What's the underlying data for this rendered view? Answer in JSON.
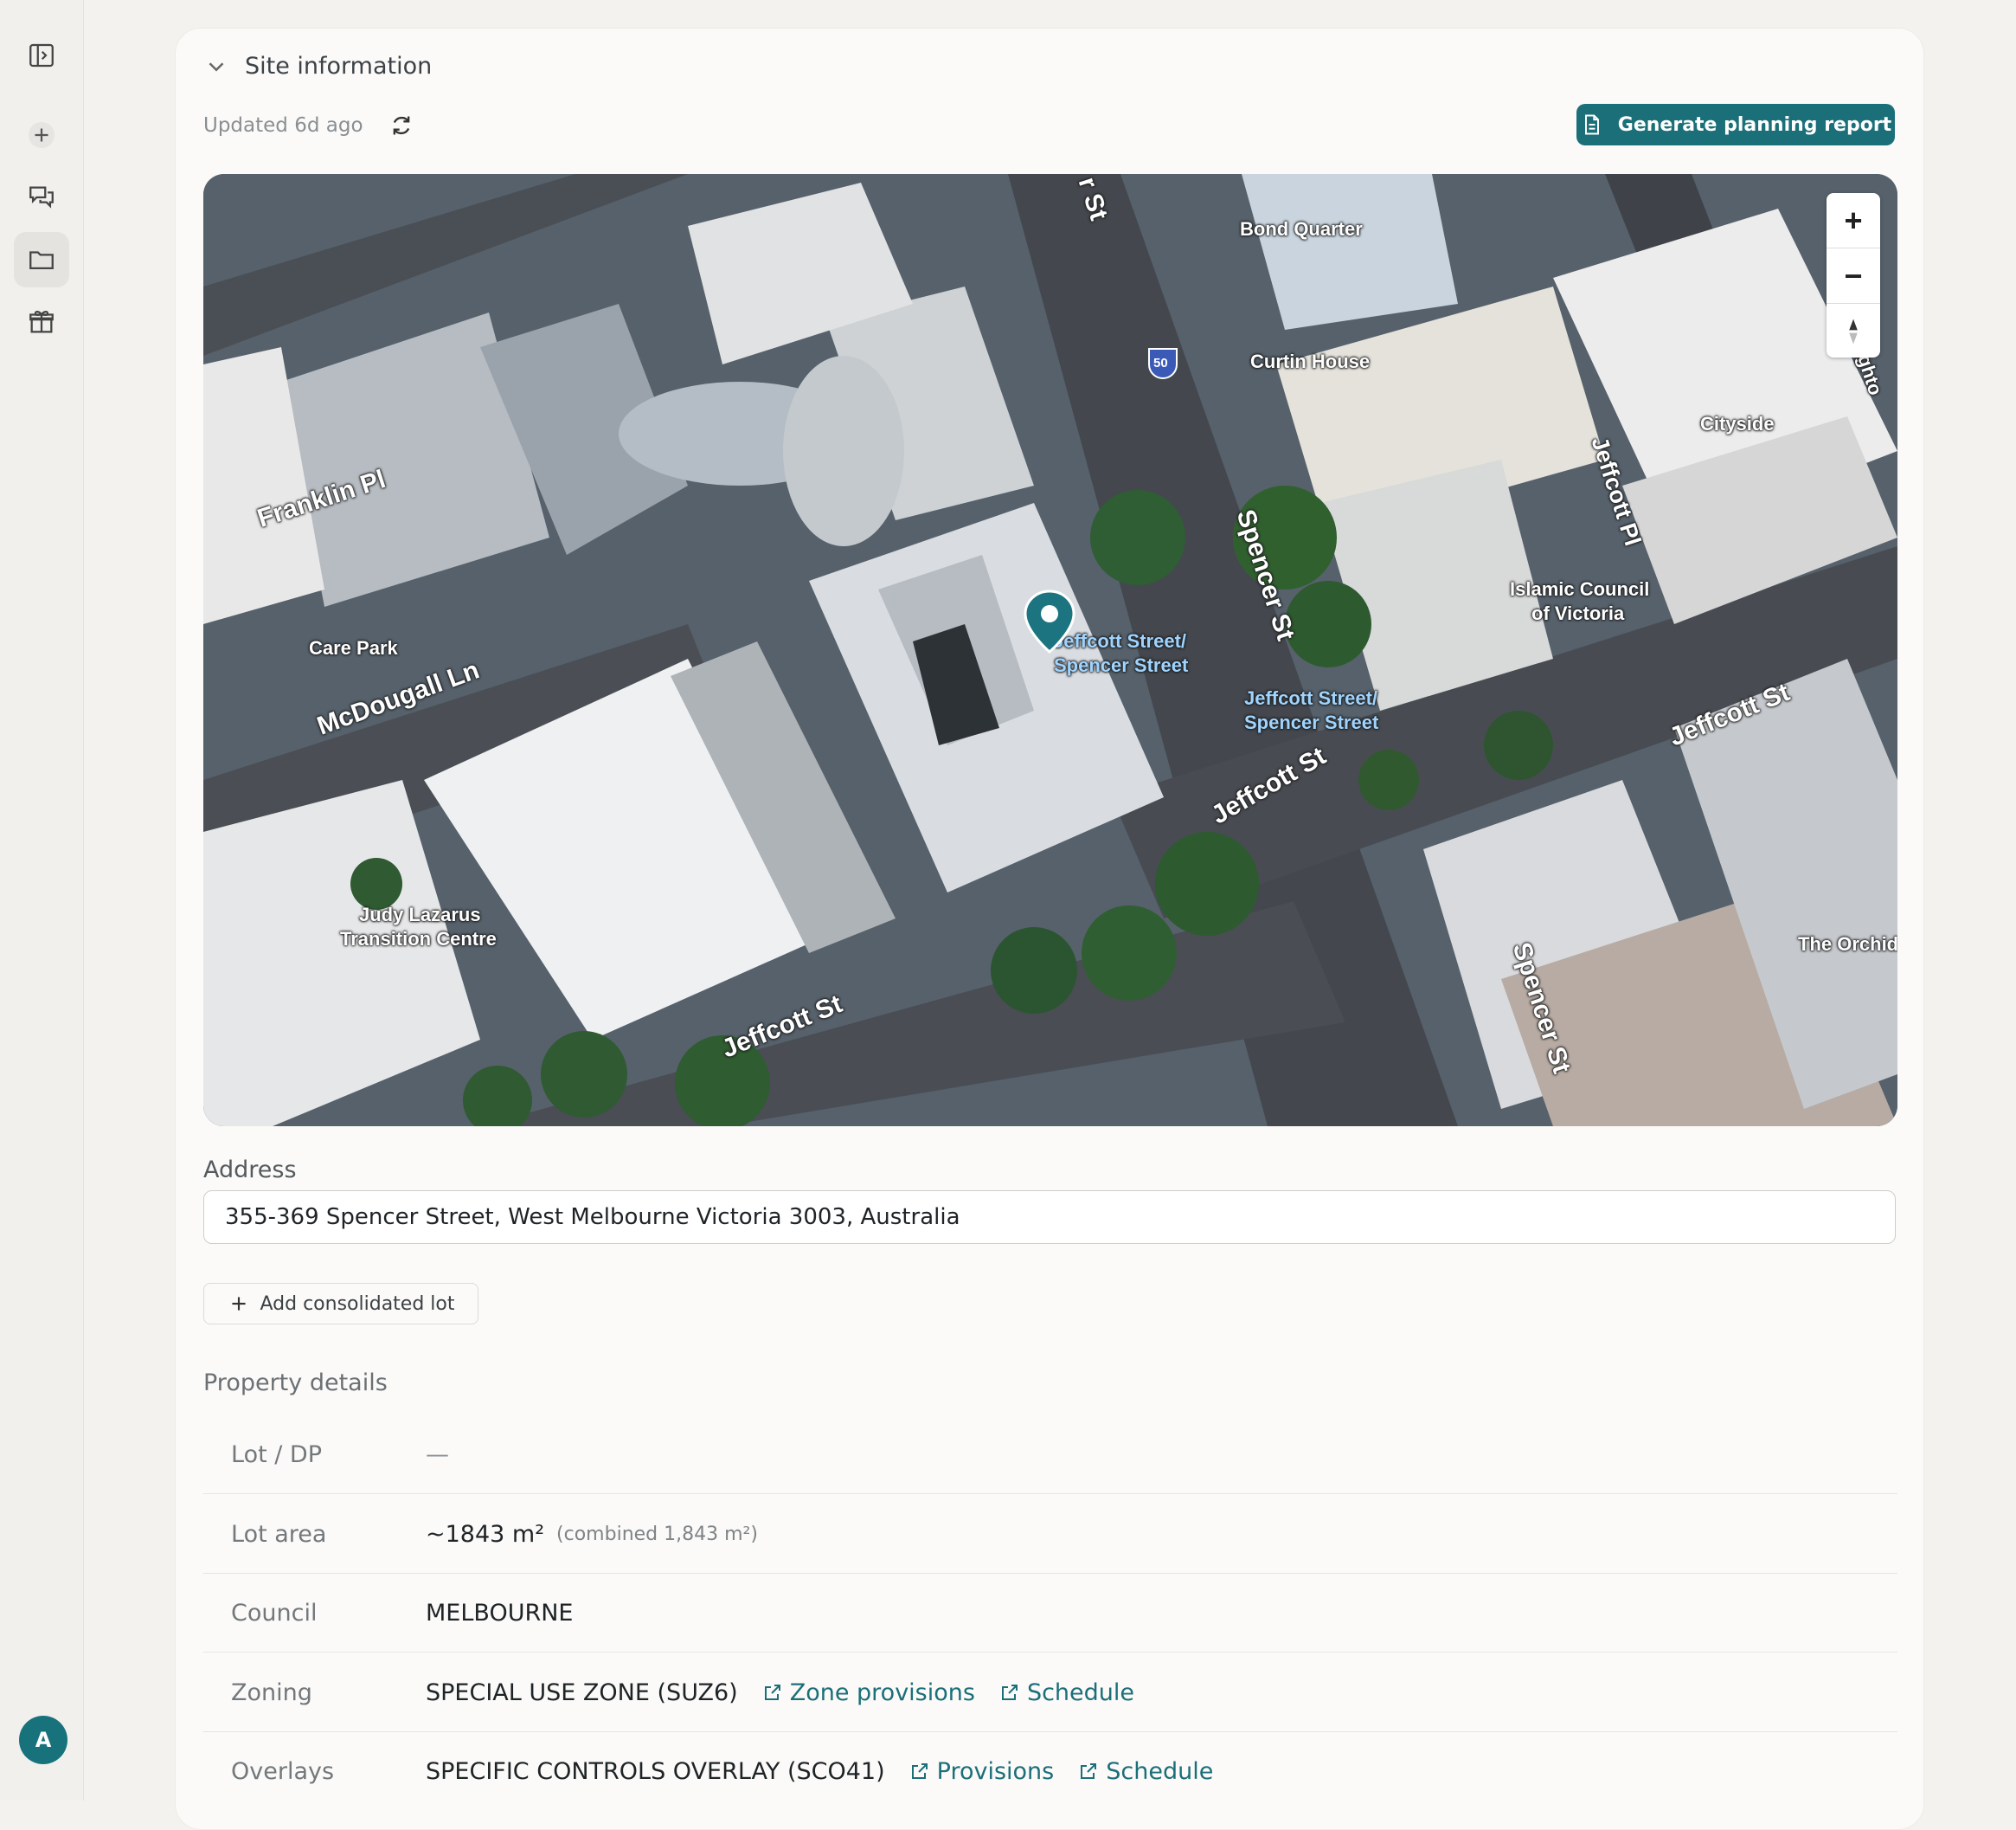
{
  "section": {
    "title": "Site information",
    "updated": "Updated 6d ago"
  },
  "actions": {
    "generate_report": "Generate planning report"
  },
  "map": {
    "labels": {
      "bond_quarter": "Bond Quarter",
      "curtin_house": "Curtin House",
      "cityside": "Cityside",
      "franklin_pl": "Franklin Pl",
      "care_park": "Care Park",
      "mcdougall_ln": "McDougall Ln",
      "spencer_st_1": "Spencer St",
      "spencer_st_2": "Spencer St",
      "spencer_st_top": "r St",
      "jeffcott_pl": "Jeffcott Pl",
      "islamic_council_1": "Islamic Council",
      "islamic_council_2": "of Victoria",
      "stop_1a": "Jeffcott Street/",
      "stop_1b": "Spencer Street",
      "stop_2a": "Jeffcott Street/",
      "stop_2b": "Spencer Street",
      "jeffcott_st_1": "Jeffcott St",
      "jeffcott_st_2": "Jeffcott St",
      "jeffcott_st_3": "Jeffcott St",
      "judy_lazarus_1": "Judy Lazarus",
      "judy_lazarus_2": "Transition Centre",
      "the_orchid": "The Orchid",
      "brighton_edge": "ighto",
      "route_shield": "50"
    },
    "zoom_in": "+",
    "zoom_out": "−"
  },
  "address": {
    "label": "Address",
    "value": "355-369 Spencer Street, West Melbourne Victoria 3003, Australia"
  },
  "add_consolidated_lot": "Add consolidated lot",
  "property_details": {
    "title": "Property details",
    "lot_dp": {
      "label": "Lot / DP",
      "value": "—"
    },
    "lot_area": {
      "label": "Lot area",
      "value": "~1843 m²",
      "combined": "(combined 1,843 m²)"
    },
    "council": {
      "label": "Council",
      "value": "MELBOURNE"
    },
    "zoning": {
      "label": "Zoning",
      "value": "SPECIAL USE ZONE (SUZ6)",
      "link1": "Zone provisions",
      "link2": "Schedule"
    },
    "overlays": {
      "label": "Overlays",
      "value": "SPECIFIC CONTROLS OVERLAY (SCO41)",
      "link1": "Provisions",
      "link2": "Schedule"
    }
  },
  "user": {
    "avatar_initial": "A"
  },
  "colors": {
    "accent": "#1b6f79",
    "avatar": "#17727c"
  }
}
